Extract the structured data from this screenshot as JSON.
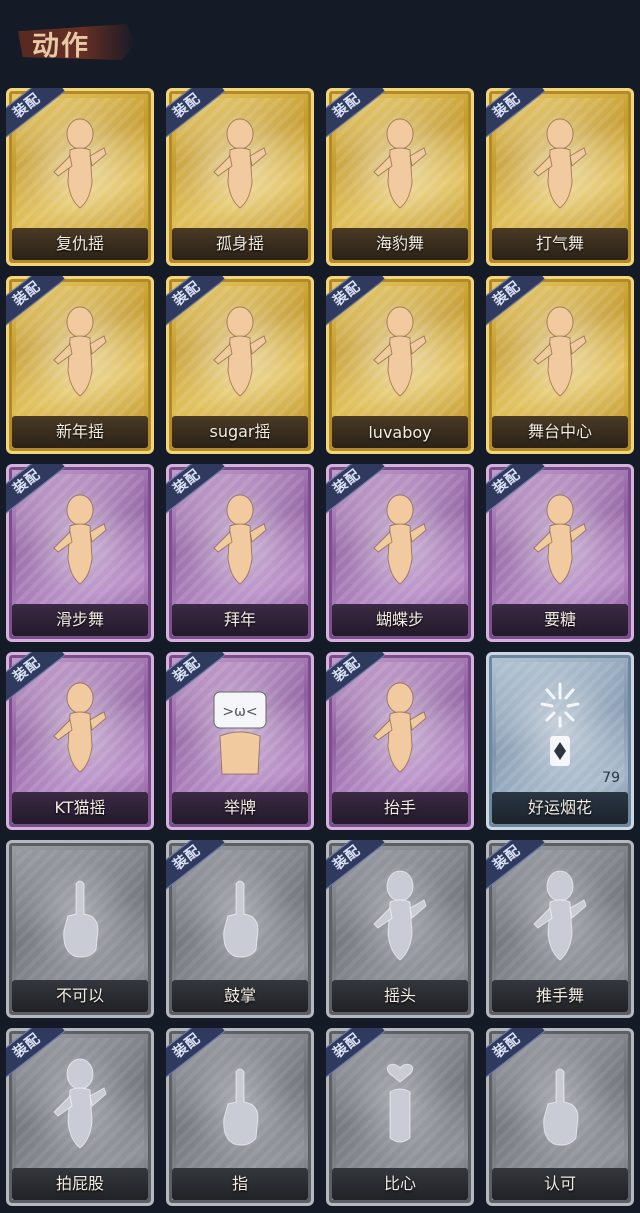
{
  "header": {
    "title": "动作"
  },
  "cards": [
    {
      "name": "复仇摇",
      "rarity": "gold",
      "badge": "装配",
      "icon": "dance-figure-icon"
    },
    {
      "name": "孤身摇",
      "rarity": "gold",
      "badge": "装配",
      "icon": "dance-figure-icon"
    },
    {
      "name": "海豹舞",
      "rarity": "gold",
      "badge": "装配",
      "icon": "dance-figure-icon"
    },
    {
      "name": "打气舞",
      "rarity": "gold",
      "badge": "装配",
      "icon": "dance-figure-icon"
    },
    {
      "name": "新年摇",
      "rarity": "gold",
      "badge": "装配",
      "icon": "dance-figure-icon"
    },
    {
      "name": "sugar摇",
      "rarity": "gold",
      "badge": "装配",
      "icon": "dance-figure-icon"
    },
    {
      "name": "luvaboy",
      "rarity": "gold",
      "badge": "装配",
      "icon": "dance-figure-icon"
    },
    {
      "name": "舞台中心",
      "rarity": "gold",
      "badge": "装配",
      "icon": "dance-figure-icon"
    },
    {
      "name": "滑步舞",
      "rarity": "purple",
      "badge": "装配",
      "icon": "dance-figure-icon"
    },
    {
      "name": "拜年",
      "rarity": "purple",
      "badge": "装配",
      "icon": "bow-figure-icon"
    },
    {
      "name": "蝴蝶步",
      "rarity": "purple",
      "badge": "装配",
      "icon": "dance-figure-icon"
    },
    {
      "name": "要糖",
      "rarity": "purple",
      "badge": "装配",
      "icon": "ghost-figure-icon"
    },
    {
      "name": "KT猫摇",
      "rarity": "purple",
      "badge": "装配",
      "icon": "dance-figure-icon"
    },
    {
      "name": "举牌",
      "rarity": "purple",
      "badge": "装配",
      "icon": "sign-figure-icon"
    },
    {
      "name": "抬手",
      "rarity": "purple",
      "badge": "装配",
      "icon": "ghost-figure-icon"
    },
    {
      "name": "好运烟花",
      "rarity": "blue",
      "badge": "",
      "icon": "firework-icon",
      "count": "79"
    },
    {
      "name": "不可以",
      "rarity": "gray",
      "badge": "",
      "icon": "finger-icon"
    },
    {
      "name": "鼓掌",
      "rarity": "gray",
      "badge": "装配",
      "icon": "clap-icon"
    },
    {
      "name": "摇头",
      "rarity": "gray",
      "badge": "装配",
      "icon": "ghost-figure-icon"
    },
    {
      "name": "推手舞",
      "rarity": "gray",
      "badge": "装配",
      "icon": "ghost-figure-icon"
    },
    {
      "name": "拍屁股",
      "rarity": "gray",
      "badge": "装配",
      "icon": "ghost-figure-icon"
    },
    {
      "name": "指",
      "rarity": "gray",
      "badge": "装配",
      "icon": "point-icon"
    },
    {
      "name": "比心",
      "rarity": "gray",
      "badge": "装配",
      "icon": "heart-hand-icon"
    },
    {
      "name": "认可",
      "rarity": "gray",
      "badge": "装配",
      "icon": "thumbs-up-icon"
    }
  ]
}
